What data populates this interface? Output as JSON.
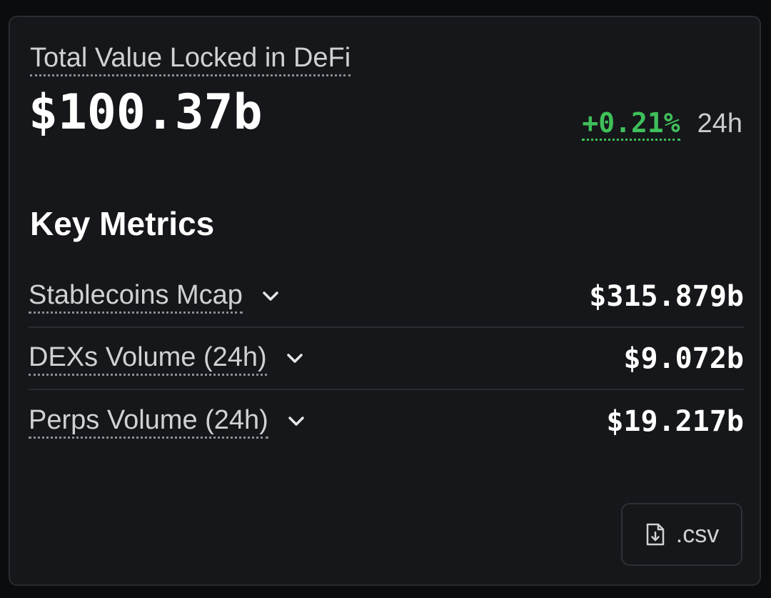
{
  "tvl": {
    "label": "Total Value Locked in DeFi",
    "value": "$100.37b",
    "change_pct": "+0.21%",
    "change_period": "24h",
    "change_color": "#3fbf5a"
  },
  "key_metrics": {
    "title": "Key Metrics",
    "items": [
      {
        "label": "Stablecoins Mcap",
        "value": "$315.879b",
        "icon": "chevron-down-icon"
      },
      {
        "label": "DEXs Volume (24h)",
        "value": "$9.072b",
        "icon": "chevron-down-icon"
      },
      {
        "label": "Perps Volume (24h)",
        "value": "$19.217b",
        "icon": "chevron-down-icon"
      }
    ]
  },
  "export": {
    "label": ".csv",
    "icon": "file-download-icon"
  }
}
